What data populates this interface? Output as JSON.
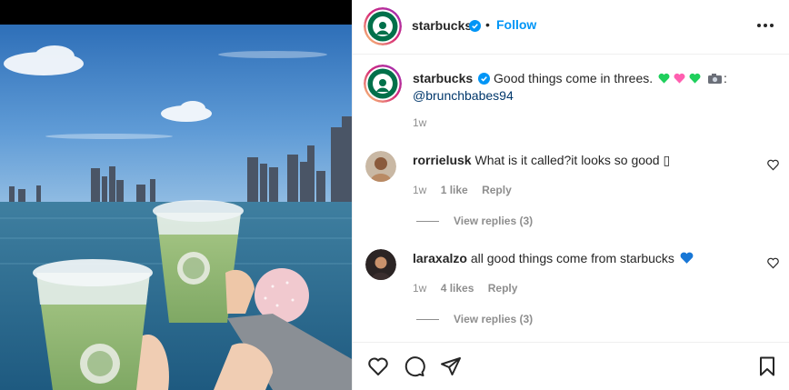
{
  "post": {
    "username": "starbucks",
    "follow_label": "Follow",
    "separator": "•"
  },
  "caption": {
    "username": "starbucks",
    "text": "Good things come in threes.",
    "text_after": ":",
    "mention": "@brunchbabes94",
    "time": "1w"
  },
  "comments": [
    {
      "username": "rorrielusk",
      "text": "What is it called?it looks so good ▯",
      "time": "1w",
      "likes": "1 like",
      "reply_label": "Reply",
      "view_replies": "View replies (3)"
    },
    {
      "username": "laraxalzo",
      "text": "all good things come from starbucks",
      "time": "1w",
      "likes": "4 likes",
      "reply_label": "Reply",
      "view_replies": "View replies (3)"
    }
  ],
  "icons": {
    "header": [
      "starbucks-logo-icon",
      "verified-badge-icon",
      "more-options-icon"
    ],
    "caption": [
      "green-heart-icon",
      "pink-heart-icon",
      "green-heart-icon",
      "camera-icon"
    ],
    "comments": [
      "blue-heart-icon",
      "like-heart-icon"
    ],
    "actions": [
      "like-icon",
      "comment-icon",
      "share-icon",
      "save-icon"
    ]
  },
  "colors": {
    "link_blue": "#0095f6",
    "verified_blue": "#0095f6",
    "mention_blue": "#00376b",
    "starbucks_green": "#00704a",
    "muted_text": "#8e8e8e"
  }
}
